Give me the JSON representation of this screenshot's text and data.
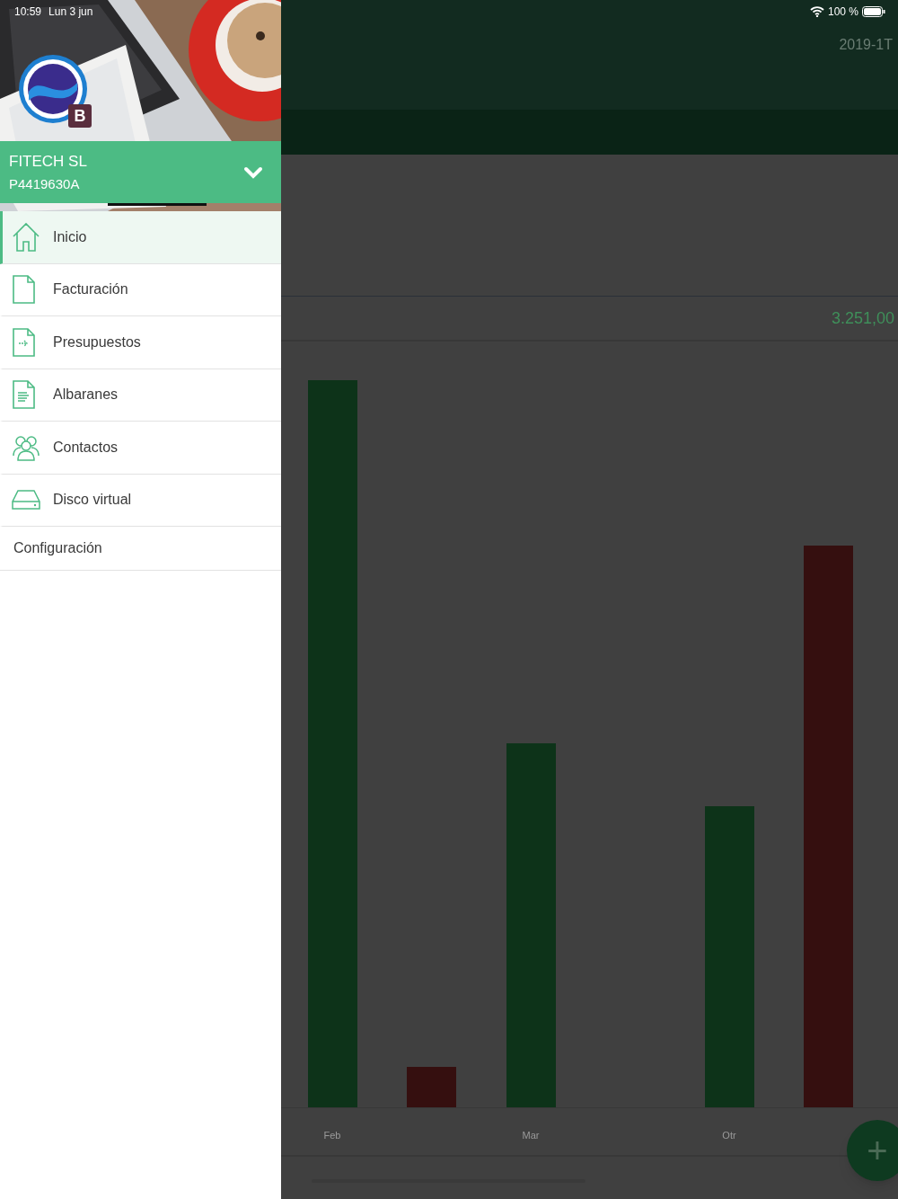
{
  "status_bar": {
    "time": "10:59",
    "date": "Lun 3 jun",
    "battery": "100 %"
  },
  "drawer": {
    "logo_badge": "B",
    "company": "FITECH SL",
    "tax_id": "P4419630A",
    "expanded": false,
    "menu": [
      {
        "label": "Inicio",
        "selected": true
      },
      {
        "label": "Facturación",
        "selected": false
      },
      {
        "label": "Presupuestos",
        "selected": false
      },
      {
        "label": "Albaranes",
        "selected": false
      },
      {
        "label": "Contactos",
        "selected": false
      },
      {
        "label": "Disco virtual",
        "selected": false
      }
    ],
    "settings_item": "Configuración"
  },
  "main": {
    "period": "2019-1T",
    "total": "3.251,00",
    "x_labels": [
      "Feb",
      "Mar",
      "Otr"
    ],
    "fab": "+"
  }
}
